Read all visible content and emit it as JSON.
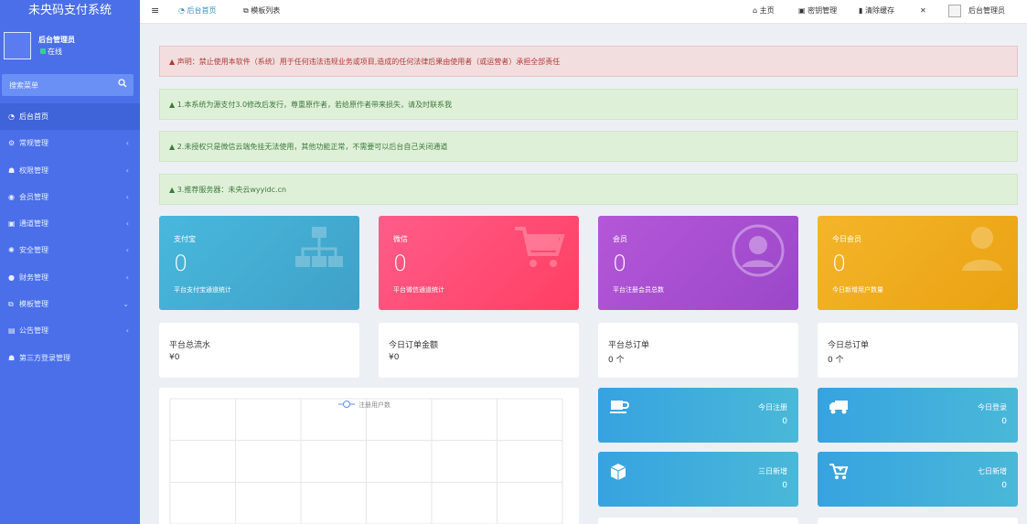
{
  "brand": "未央码支付系统",
  "user": {
    "name": "后台管理员",
    "status": "在线"
  },
  "search": {
    "placeholder": "搜索菜单"
  },
  "sidebar": {
    "items": [
      {
        "label": "后台首页",
        "icon": "dashboard-icon"
      },
      {
        "label": "常规管理",
        "icon": "cogs-icon"
      },
      {
        "label": "权限管理",
        "icon": "group-icon"
      },
      {
        "label": "会员管理",
        "icon": "user-circle-icon"
      },
      {
        "label": "通道管理",
        "icon": "channel-icon"
      },
      {
        "label": "安全管理",
        "icon": "gear-icon"
      },
      {
        "label": "财务管理",
        "icon": "finance-icon"
      },
      {
        "label": "模板管理",
        "icon": "template-icon"
      },
      {
        "label": "公告管理",
        "icon": "notice-icon"
      },
      {
        "label": "第三方登录管理",
        "icon": "group-icon"
      }
    ]
  },
  "topbar": {
    "tabs": [
      {
        "label": "后台首页",
        "icon": "dashboard-icon"
      },
      {
        "label": "模板列表",
        "icon": "template-icon"
      }
    ],
    "right": {
      "home": "主页",
      "secret": "密钥管理",
      "clear_cache": "清除缓存",
      "admin": "后台管理员"
    }
  },
  "alerts": [
    {
      "type": "danger",
      "text": "▲ 声明：禁止使用本软件（系统）用于任何违法违规业务或项目,造成的任何法律后果由使用者（或运营者）承担全部责任"
    },
    {
      "type": "success",
      "text": "▲ 1.本系统为源支付3.0修改后发行，尊重原作者，若给原作者带来损失，请及时联系我"
    },
    {
      "type": "success",
      "text": "▲ 2.未授权只是微信云端免挂无法使用，其他功能正常，不需要可以后台自己关闭通道"
    },
    {
      "type": "success",
      "text": "▲ 3.推荐服务器：未央云wyyidc.cn"
    }
  ],
  "cards": [
    {
      "title": "支付宝",
      "value": "0",
      "desc": "平台支付宝通道统计",
      "color": "#45b0d4",
      "icon": "sitemap-icon"
    },
    {
      "title": "微信",
      "value": "0",
      "desc": "平台微信通道统计",
      "color": "#ff4f7a",
      "icon": "cart-icon"
    },
    {
      "title": "会员",
      "value": "0",
      "desc": "平台注册会员总数",
      "color": "#a850d0",
      "icon": "user-circle-icon"
    },
    {
      "title": "今日会员",
      "value": "0",
      "desc": "今日新增用户数量",
      "color": "#f0ac1e",
      "icon": "user-icon"
    }
  ],
  "stats": [
    {
      "label": "平台总流水",
      "value": "¥0"
    },
    {
      "label": "今日订单金额",
      "value": "¥0"
    },
    {
      "label": "平台总订单",
      "value": "0 个"
    },
    {
      "label": "今日总订单",
      "value": "0 个"
    }
  ],
  "chart_data": {
    "type": "line",
    "series": [
      {
        "name": "注册用户数",
        "values": []
      }
    ],
    "grid": true,
    "legend": "top-center"
  },
  "minis": [
    {
      "label": "今日注册",
      "value": "0",
      "icon": "coffee-icon",
      "color": "#3fa9e0"
    },
    {
      "label": "今日登录",
      "value": "0",
      "icon": "truck-icon",
      "color": "#3fa9e0"
    },
    {
      "label": "三日新增",
      "value": "0",
      "icon": "cube-icon",
      "color": "#3fa9e0"
    },
    {
      "label": "七日新增",
      "value": "0",
      "icon": "cart-plus-icon",
      "color": "#3fa9e0"
    }
  ]
}
